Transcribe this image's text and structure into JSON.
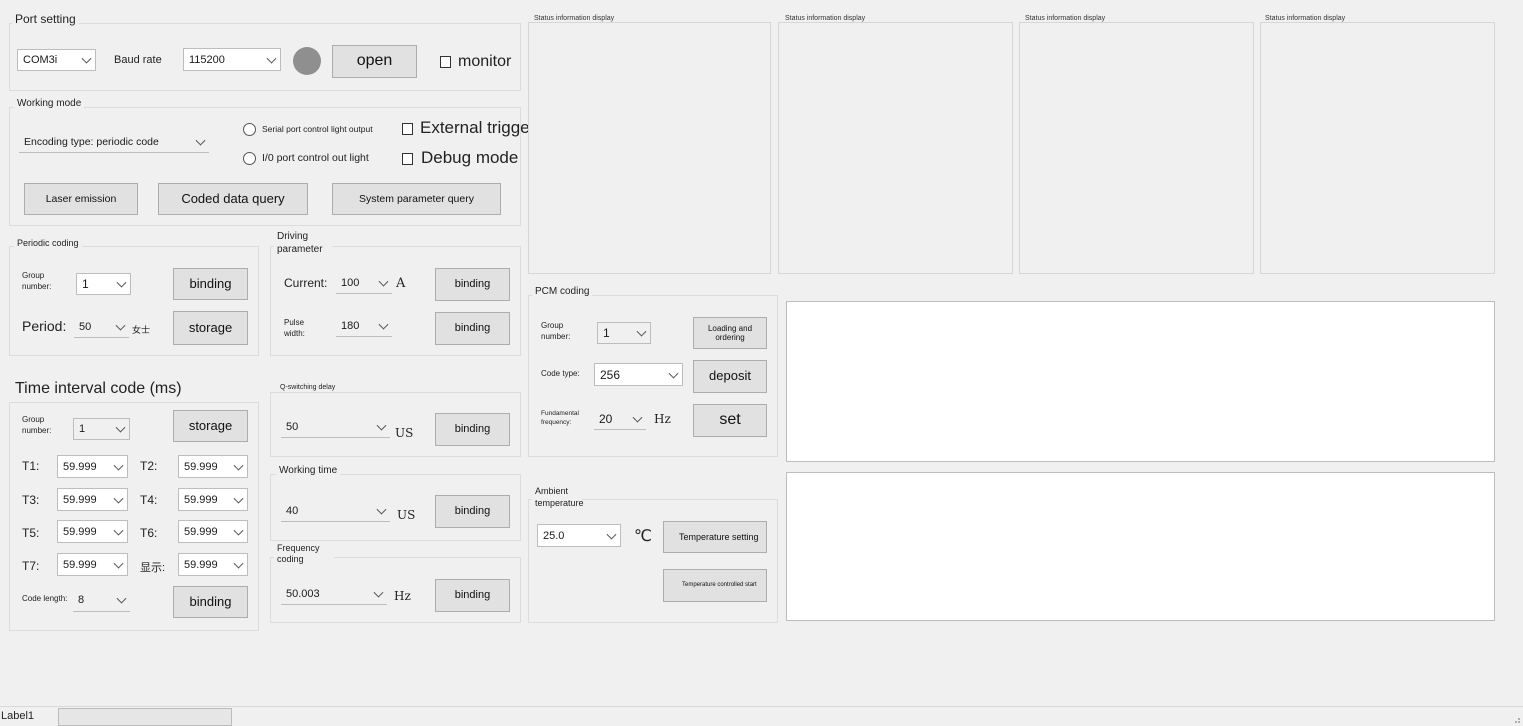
{
  "status_panels": {
    "title1": "Status information display",
    "title2": "Status information display",
    "title3": "Status information display",
    "title4": "Status information display"
  },
  "port_setting": {
    "title": "Port setting",
    "port_value": "COM3i",
    "baud_label": "Baud rate",
    "baud_value": "115200",
    "open_label": "open",
    "monitor_label": "monitor",
    "indicator_color": "#8f8f8f"
  },
  "working_mode": {
    "title": "Working mode",
    "encoding_value": "Encoding type: periodic code",
    "radio_serial": "Serial port control light output",
    "radio_io": "I/0 port control out light",
    "external_trigger": "External trigger",
    "debug_mode": "Debug mode",
    "laser_btn": "Laser emission",
    "coded_btn": "Coded data query",
    "system_btn": "System parameter query"
  },
  "periodic_coding": {
    "title": "Periodic coding",
    "group_label": "Group number:",
    "group_value": "1",
    "binding_btn": "binding",
    "period_label": "Period:",
    "period_value": "50",
    "period_unit": "女士",
    "storage_btn": "storage"
  },
  "driving_parameter": {
    "title": "Driving parameter",
    "current_label": "Current:",
    "current_value": "100",
    "current_unit": "A",
    "binding1": "binding",
    "pulse_label": "Pulse width:",
    "pulse_value": "180",
    "binding2": "binding"
  },
  "time_interval": {
    "title": "Time interval code (ms)",
    "group_label": "Group number:",
    "group_value": "1",
    "storage_btn": "storage",
    "t1_label": "T1:",
    "t1_value": "59.999",
    "t2_label": "T2:",
    "t2_value": "59.999",
    "t3_label": "T3:",
    "t3_value": "59.999",
    "t4_label": "T4:",
    "t4_value": "59.999",
    "t5_label": "T5:",
    "t5_value": "59.999",
    "t6_label": "T6:",
    "t6_value": "59.999",
    "t7_label": "T7:",
    "t7_value": "59.999",
    "t8_label": "显示:",
    "t8_value": "59.999",
    "code_length_label": "Code length:",
    "code_length_value": "8",
    "binding_btn": "binding"
  },
  "q_switching": {
    "title": "Q-switching delay",
    "value": "50",
    "unit": "US",
    "binding_btn": "binding"
  },
  "working_time": {
    "title": "Working time",
    "value": "40",
    "unit": "US",
    "binding_btn": "binding"
  },
  "frequency_coding": {
    "title": "Frequency coding",
    "value": "50.003",
    "unit": "Hz",
    "binding_btn": "binding"
  },
  "pcm_coding": {
    "title": "PCM coding",
    "group_label": "Group number:",
    "group_value": "1",
    "loading_btn": "Loading and ordering",
    "code_type_label": "Code type:",
    "code_type_value": "256",
    "deposit_btn": "deposit",
    "fund_label": "Fundamental frequency:",
    "fund_value": "20",
    "fund_unit": "Hz",
    "set_btn": "set"
  },
  "ambient": {
    "title": "Ambient temperature",
    "value": "25.0",
    "unit": "℃",
    "temp_setting_btn": "Temperature setting",
    "temp_start_btn": "Temperature controlled start"
  },
  "status_bar": {
    "label": "Label1"
  }
}
